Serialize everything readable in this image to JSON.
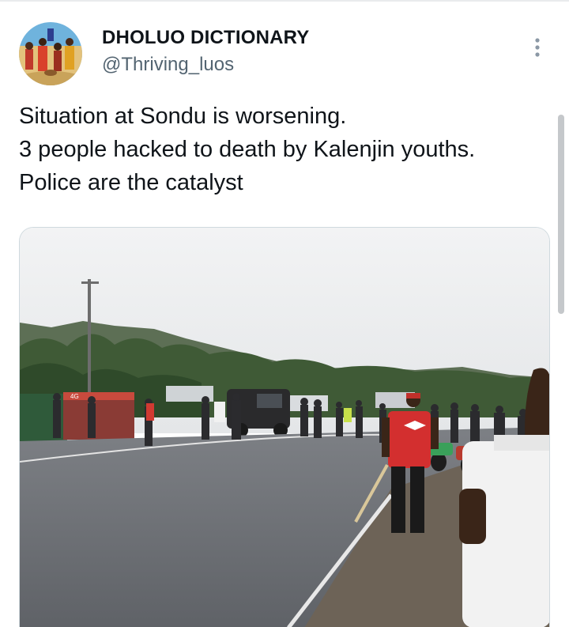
{
  "author": {
    "display_name": "DHOLUO DICTIONARY",
    "handle": "@Thriving_luos",
    "avatar_icon": "avatar-photo"
  },
  "menu": {
    "icon": "more-options-icon"
  },
  "tweet": {
    "lines": [
      "Situation at Sondu is worsening.",
      "3 people hacked to death by Kalenjin youths.",
      "Police are the catalyst"
    ]
  },
  "media": {
    "shop_sign": "4G"
  },
  "colors": {
    "text_primary": "#0f1419",
    "text_secondary": "#536471",
    "border": "#cfd9de"
  }
}
